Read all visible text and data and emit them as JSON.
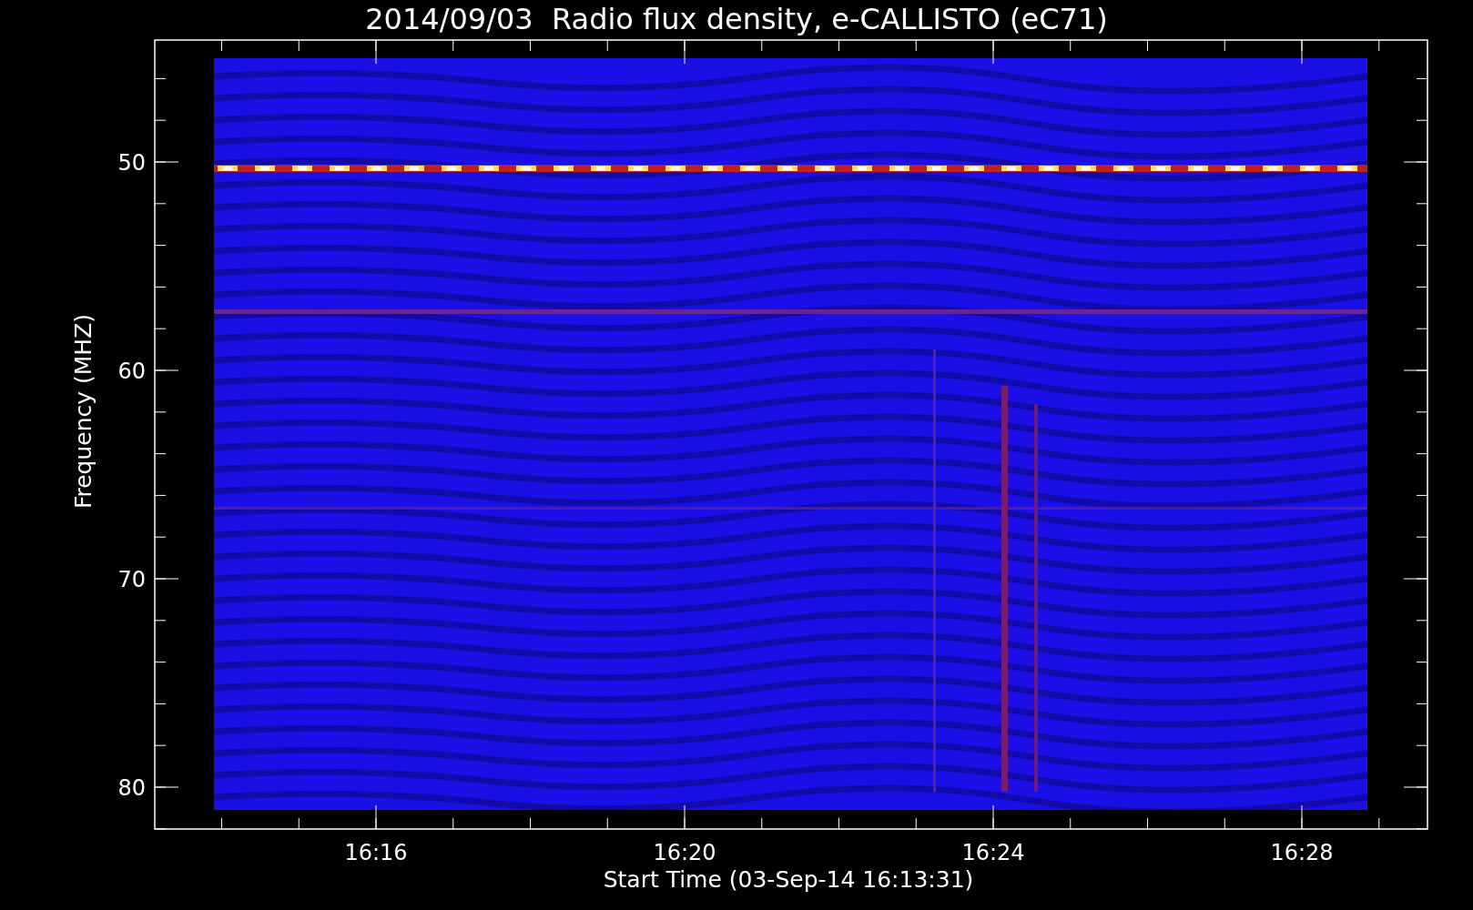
{
  "title": "2014/09/03  Radio flux density, e-CALLISTO (eC71)",
  "y_axis": {
    "label": "Frequency (MHZ)",
    "ticks": [
      "50",
      "60",
      "70",
      "80"
    ]
  },
  "x_axis": {
    "label": "Start Time (03-Sep-14 16:13:31)",
    "ticks": [
      "16:16",
      "16:20",
      "16:24",
      "16:28"
    ]
  }
}
